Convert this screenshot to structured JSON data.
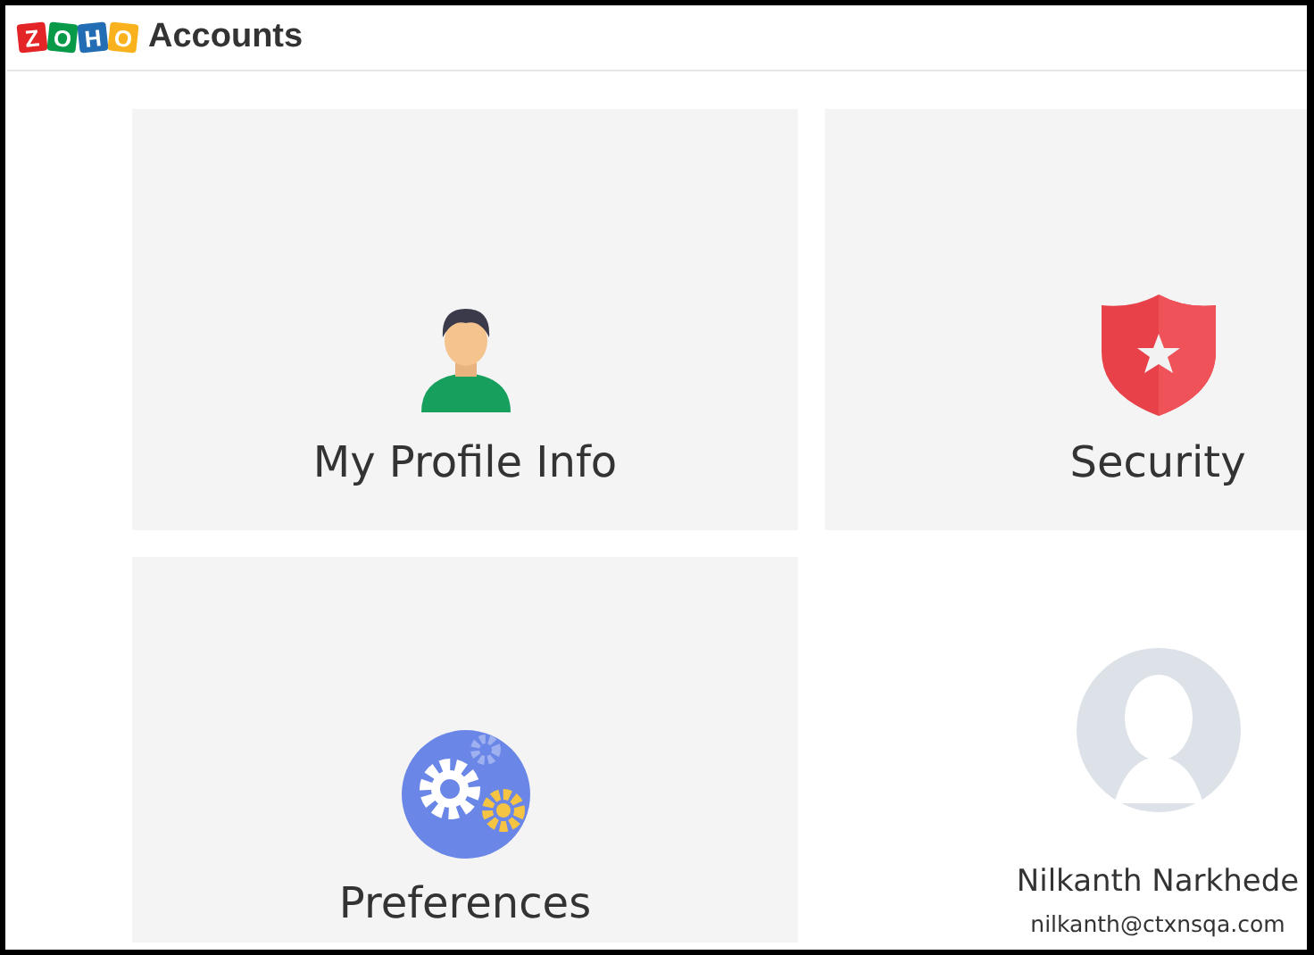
{
  "header": {
    "logo": [
      {
        "letter": "Z",
        "color": "#e42527"
      },
      {
        "letter": "O",
        "color": "#089949"
      },
      {
        "letter": "H",
        "color": "#226db4"
      },
      {
        "letter": "O",
        "color": "#f9b21d"
      }
    ],
    "title": "Accounts"
  },
  "cards": [
    {
      "kind": "profile",
      "label": "My Profile Info"
    },
    {
      "kind": "security",
      "label": "Security"
    },
    {
      "kind": "preferences",
      "label": "Preferences"
    }
  ],
  "user_card": {
    "name": "Nilkanth Narkhede",
    "email": "nilkanth@ctxnsqa.com"
  }
}
